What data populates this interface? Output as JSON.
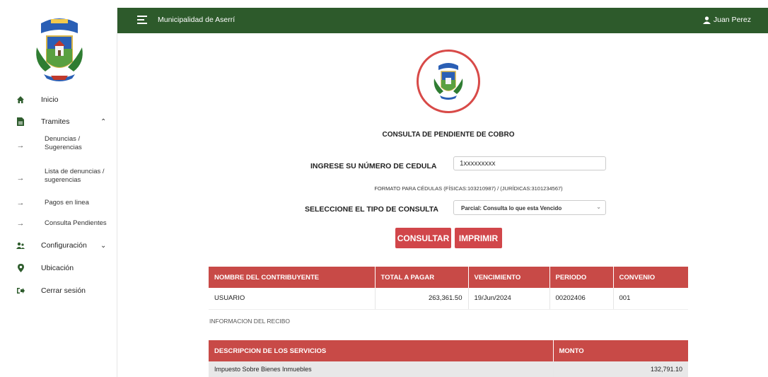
{
  "topbar": {
    "title": "Municipalidad de Aserrí",
    "user": "Juan Perez"
  },
  "sidebar": {
    "items": [
      {
        "label": "Inicio",
        "icon": "home-icon"
      },
      {
        "label": "Tramites",
        "icon": "document-icon"
      },
      {
        "label": "Denuncias / Sugerencias",
        "icon": "arrow-right-icon"
      },
      {
        "label": "Lista de denuncias / sugerencias",
        "icon": "arrow-right-icon"
      },
      {
        "label": "Pagos en linea",
        "icon": "arrow-right-icon"
      },
      {
        "label": "Consulta Pendientes",
        "icon": "arrow-right-icon"
      },
      {
        "label": "Configuración",
        "icon": "users-icon"
      },
      {
        "label": "Ubicación",
        "icon": "location-pin-icon"
      },
      {
        "label": "Cerrar sesión",
        "icon": "logout-icon"
      }
    ]
  },
  "main": {
    "title": "CONSULTA DE PENDIENTE DE COBRO",
    "cedula_label": "INGRESE SU NÚMERO DE CEDULA",
    "cedula_value": "1xxxxxxxxx",
    "hint": "FORMATO PARA CÉDULAS (FÍSICAS:103210987) / (JURÍDICAS:3101234567)",
    "tipo_label": "SELECCIONE EL TIPO DE CONSULTA",
    "tipo_value": "Parcial: Consulta lo que esta Vencido",
    "consultar": "CONSULTAR",
    "imprimir": "IMPRIMIR"
  },
  "summary_table": {
    "headers": [
      "NOMBRE DEL CONTRIBUYENTE",
      "TOTAL A PAGAR",
      "VENCIMIENTO",
      "PERIODO",
      "CONVENIO"
    ],
    "row": [
      "USUARIO",
      "263,361.50",
      "19/Jun/2024",
      "00202406",
      "001"
    ]
  },
  "receipt_label": "INFORMACION DEL RECIBO",
  "services_table": {
    "headers": [
      "DESCRIPCION DE LOS SERVICIOS",
      "MONTO"
    ],
    "row": [
      "Impuesto Sobre Bienes Inmuebles",
      "132,791.10"
    ]
  },
  "colors": {
    "topbar": "#2d5a2b",
    "accent": "#d1464a"
  }
}
